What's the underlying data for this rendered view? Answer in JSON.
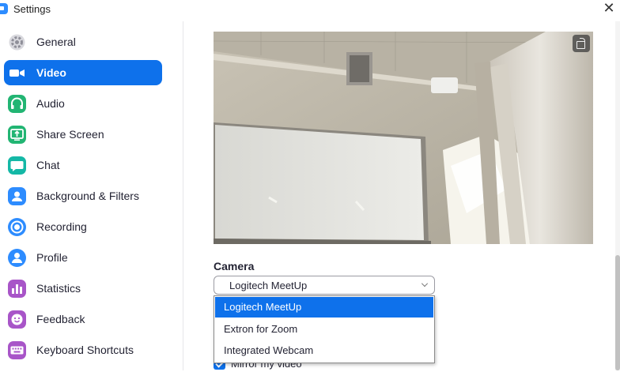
{
  "window": {
    "title": "Settings",
    "close_glyph": "✕"
  },
  "sidebar": {
    "items": [
      {
        "label": "General",
        "icon": "gear-icon",
        "color": "#8f8f99"
      },
      {
        "label": "Video",
        "icon": "video-camera-icon",
        "color": "#ffffff",
        "active": true
      },
      {
        "label": "Audio",
        "icon": "headphones-icon",
        "color": "#22b573"
      },
      {
        "label": "Share Screen",
        "icon": "share-screen-icon",
        "color": "#22b573"
      },
      {
        "label": "Chat",
        "icon": "chat-bubble-icon",
        "color": "#14b8a6"
      },
      {
        "label": "Background & Filters",
        "icon": "person-background-icon",
        "color": "#2d8cff"
      },
      {
        "label": "Recording",
        "icon": "record-icon",
        "color": "#2d8cff"
      },
      {
        "label": "Profile",
        "icon": "profile-icon",
        "color": "#2d8cff"
      },
      {
        "label": "Statistics",
        "icon": "bar-chart-icon",
        "color": "#a855c8"
      },
      {
        "label": "Feedback",
        "icon": "smiley-icon",
        "color": "#a855c8"
      },
      {
        "label": "Keyboard Shortcuts",
        "icon": "keyboard-icon",
        "color": "#a855c8"
      }
    ]
  },
  "video": {
    "camera_label": "Camera",
    "selected_camera": "Logitech MeetUp",
    "camera_options": [
      "Logitech MeetUp",
      "Extron for Zoom",
      "Integrated Webcam"
    ],
    "mirror_label": "Mirror my video",
    "mirror_checked": true
  },
  "colors": {
    "accent": "#0e71eb"
  }
}
